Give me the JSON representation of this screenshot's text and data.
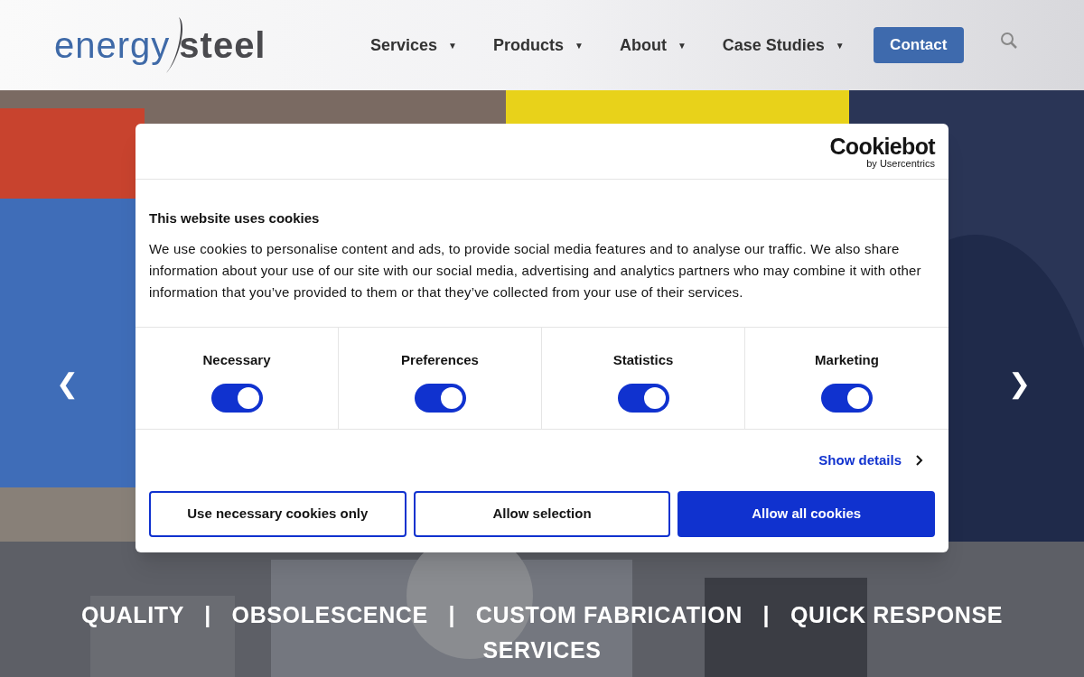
{
  "header": {
    "logo": {
      "part_1": "energy",
      "part_2": "steel"
    },
    "nav": [
      {
        "label": "Services",
        "caret": "▼"
      },
      {
        "label": "Products",
        "caret": "▼"
      },
      {
        "label": "About",
        "caret": "▼"
      },
      {
        "label": "Case Studies",
        "caret": "▼"
      }
    ],
    "contact_button": "Contact"
  },
  "hero": {
    "prev": "❮",
    "next": "❯",
    "tagline": "QUALITY   |   OBSOLESCENCE   |   CUSTOM FABRICATION   |   QUICK RESPONSE SERVICES"
  },
  "cookie_dialog": {
    "brand": "Cookiebot",
    "brand_sub": "by Usercentrics",
    "title": "This website uses cookies",
    "body": "We use cookies to personalise content and ads, to provide social media features and to analyse our traffic. We also share information about your use of our site with our social media, advertising and analytics partners who may combine it with other information that you’ve provided to them or that they’ve collected from your use of their services.",
    "categories": [
      {
        "label": "Necessary",
        "checked": true
      },
      {
        "label": "Preferences",
        "checked": true
      },
      {
        "label": "Statistics",
        "checked": true
      },
      {
        "label": "Marketing",
        "checked": true
      }
    ],
    "show_details": "Show details",
    "buttons": [
      {
        "label": "Use necessary cookies only",
        "kind": "outline"
      },
      {
        "label": "Allow selection",
        "kind": "outline"
      },
      {
        "label": "Allow all cookies",
        "kind": "primary"
      }
    ]
  }
}
